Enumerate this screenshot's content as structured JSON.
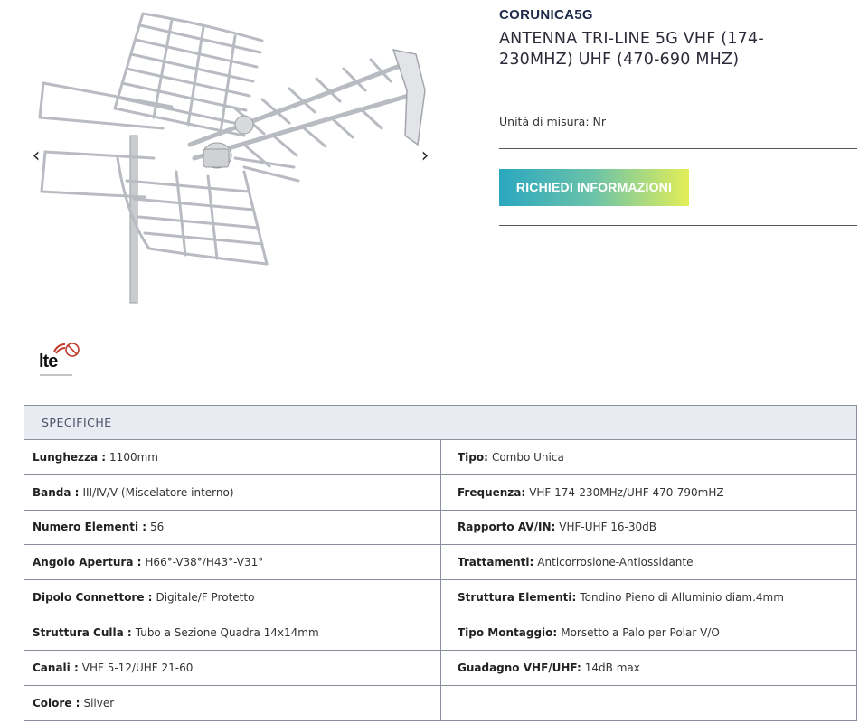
{
  "gallery": {
    "prev_icon": "chevron-left-icon",
    "next_icon": "chevron-right-icon",
    "prev_glyph": "‹",
    "next_glyph": "›"
  },
  "lte_logo": {
    "text": "lte"
  },
  "product": {
    "brand": "CORUNICA5G",
    "title": "ANTENNA TRI-LINE 5G VHF (174-230MHZ) UHF (470-690 MHZ)",
    "unit": "Unità di misura: Nr",
    "cta_label": "RICHIEDI INFORMAZIONI"
  },
  "specs": {
    "heading": "SPECIFICHE",
    "rows": [
      {
        "left_key": "Lunghezza :",
        "left_val": "1100mm",
        "right_key": "Tipo:",
        "right_val": "Combo Unica"
      },
      {
        "left_key": "Banda :",
        "left_val": "III/IV/V (Miscelatore interno)",
        "right_key": "Frequenza:",
        "right_val": "VHF 174-230MHz/UHF 470-790mHZ"
      },
      {
        "left_key": "Numero Elementi :",
        "left_val": "56",
        "right_key": "Rapporto AV/IN:",
        "right_val": "VHF-UHF 16-30dB"
      },
      {
        "left_key": "Angolo Apertura :",
        "left_val": "H66°-V38°/H43°-V31°",
        "right_key": "Trattamenti:",
        "right_val": "Anticorrosione-Antiossidante"
      },
      {
        "left_key": "Dipolo Connettore :",
        "left_val": "Digitale/F Protetto",
        "right_key": "Struttura Elementi:",
        "right_val": "Tondino Pieno di Alluminio diam.4mm"
      },
      {
        "left_key": "Struttura Culla :",
        "left_val": "Tubo a Sezione Quadra 14x14mm",
        "right_key": "Tipo Montaggio:",
        "right_val": "Morsetto a Palo per Polar V/O"
      },
      {
        "left_key": "Canali :",
        "left_val": "VHF 5-12/UHF 21-60",
        "right_key": "Guadagno VHF/UHF:",
        "right_val": "14dB max"
      },
      {
        "left_key": "Colore :",
        "left_val": "Silver",
        "right_key": "",
        "right_val": ""
      }
    ]
  },
  "colors": {
    "brand": "#1e2a4a",
    "button_gradient_start": "#2aa7c0",
    "button_gradient_end": "#e3ee58",
    "specs_header_bg": "#e9ebf2"
  }
}
